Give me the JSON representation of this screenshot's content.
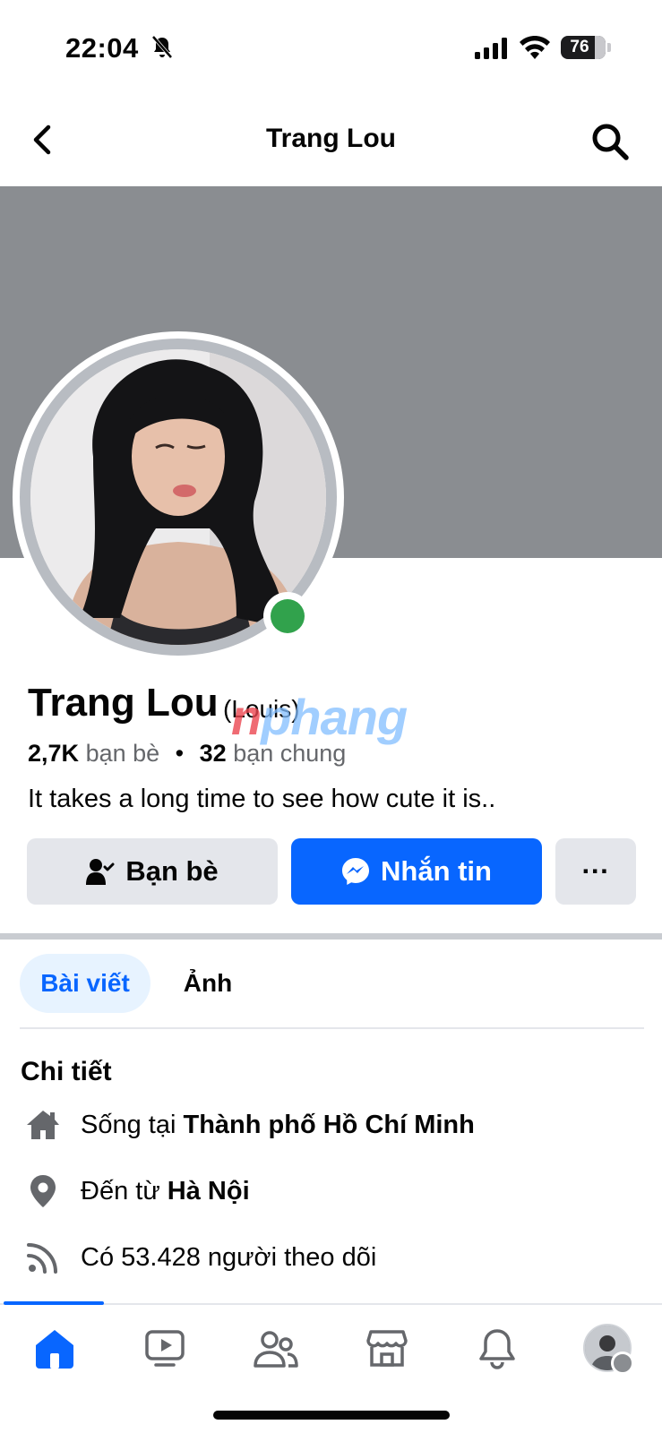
{
  "status_bar": {
    "time": "22:04",
    "battery": "76",
    "battery_level": 0.76
  },
  "nav": {
    "title": "Trang Lou"
  },
  "profile": {
    "name": "Trang Lou",
    "alt_name": "(Louis)",
    "friends_count": "2,7K",
    "friends_label": "bạn bè",
    "mutual_count": "32",
    "mutual_label": "bạn chung",
    "bio": "It takes a long time to see how cute it is..",
    "online": true
  },
  "watermark": {
    "prefix": "n",
    "rest": "phang"
  },
  "actions": {
    "friends_label": "Bạn bè",
    "message_label": "Nhắn tin",
    "more_label": "···"
  },
  "tabs": [
    {
      "label": "Bài viết",
      "active": true
    },
    {
      "label": "Ảnh",
      "active": false
    }
  ],
  "details": {
    "title": "Chi tiết",
    "rows": [
      {
        "icon": "home-icon",
        "prefix": "Sống tại ",
        "value": "Thành phố Hồ Chí Minh"
      },
      {
        "icon": "location-pin-icon",
        "prefix": "Đến từ ",
        "value": "Hà Nội"
      },
      {
        "icon": "rss-feed-icon",
        "prefix": "Có 53.428 người theo dõi",
        "value": ""
      }
    ]
  },
  "bottom_tabs": [
    {
      "name": "home",
      "icon": "home-filled-icon",
      "active": true
    },
    {
      "name": "video",
      "icon": "video-icon",
      "active": false
    },
    {
      "name": "friends",
      "icon": "friends-icon",
      "active": false
    },
    {
      "name": "marketplace",
      "icon": "marketplace-icon",
      "active": false
    },
    {
      "name": "notifications",
      "icon": "bell-icon",
      "active": false
    },
    {
      "name": "menu",
      "icon": "profile-avatar-icon",
      "active": false
    }
  ],
  "colors": {
    "accent": "#0866ff",
    "online": "#31a24c",
    "cover": "#8a8d91",
    "secondary_text": "#65676b"
  }
}
